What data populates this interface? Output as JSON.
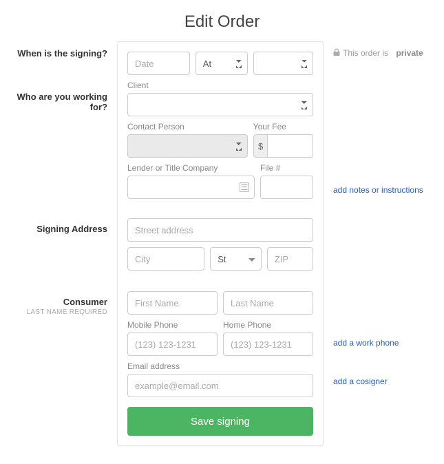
{
  "title": "Edit Order",
  "privacy": {
    "prefix": "This order is",
    "status": "private"
  },
  "sections": {
    "signing_time": {
      "label": "When is the signing?"
    },
    "working_for": {
      "label": "Who are you working for?"
    },
    "signing_address": {
      "label": "Signing Address"
    },
    "consumer": {
      "label": "Consumer",
      "sublabel": "LAST NAME REQUIRED"
    }
  },
  "fields": {
    "date": {
      "placeholder": "Date",
      "value": ""
    },
    "at": {
      "label": "At",
      "value": ""
    },
    "time": {
      "value": ""
    },
    "client": {
      "label": "Client",
      "value": ""
    },
    "contact_person": {
      "label": "Contact Person",
      "value": ""
    },
    "your_fee": {
      "label": "Your Fee",
      "currency": "$",
      "value": ""
    },
    "lender": {
      "label": "Lender or Title Company",
      "value": ""
    },
    "file_no": {
      "label": "File #",
      "value": ""
    },
    "street": {
      "placeholder": "Street address",
      "value": ""
    },
    "city": {
      "placeholder": "City",
      "value": ""
    },
    "state": {
      "placeholder": "St",
      "value": ""
    },
    "zip": {
      "placeholder": "ZIP",
      "value": ""
    },
    "first_name": {
      "placeholder": "First Name",
      "value": ""
    },
    "last_name": {
      "placeholder": "Last Name",
      "value": ""
    },
    "mobile_phone": {
      "label": "Mobile Phone",
      "placeholder": "(123) 123-1231",
      "value": ""
    },
    "home_phone": {
      "label": "Home Phone",
      "placeholder": "(123) 123-1231",
      "value": ""
    },
    "email": {
      "label": "Email address",
      "placeholder": "example@email.com",
      "value": ""
    }
  },
  "links": {
    "notes": "add notes or instructions",
    "work_phone": "add a work phone",
    "cosigner": "add a cosigner"
  },
  "buttons": {
    "save": "Save signing"
  }
}
